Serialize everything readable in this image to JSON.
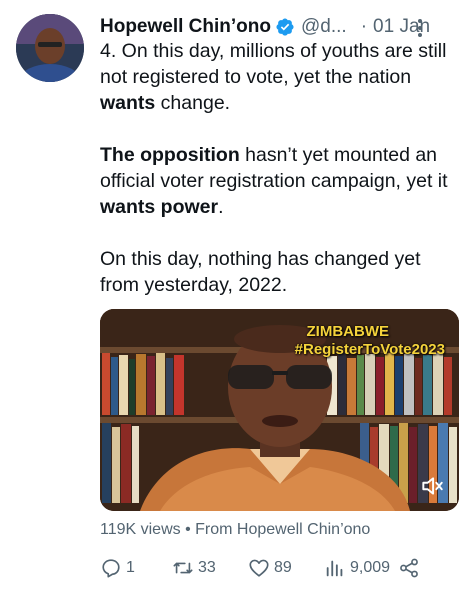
{
  "tweet": {
    "author_name": "Hopewell Chin’ono",
    "handle": "@d...",
    "separator": "·",
    "date": "01 Jan",
    "paragraphs": [
      [
        {
          "text": "4. On this day, millions of youths are still not registered to vote, yet the nation ",
          "bold": false
        },
        {
          "text": "wants",
          "bold": true
        },
        {
          "text": " change.",
          "bold": false
        }
      ],
      [
        {
          "text": "The opposition",
          "bold": true
        },
        {
          "text": " hasn’t yet mounted an official voter registration campaign, yet it ",
          "bold": false
        },
        {
          "text": "wants power",
          "bold": true
        },
        {
          "text": ".",
          "bold": false
        }
      ],
      [
        {
          "text": "On this day, nothing has changed yet from yesterday, 2022.",
          "bold": false
        }
      ]
    ],
    "media": {
      "overlay_line1": "ZIMBABWE",
      "overlay_line2": "#RegisterToVote2023",
      "overlay_color": "#f5d33b",
      "mute_icon": "speaker-muted-icon"
    },
    "views_line": "119K views • From Hopewell Chin’ono",
    "actions": {
      "replies": "1",
      "retweets": "33",
      "likes": "89",
      "views": "9,009"
    },
    "verified_color": "#1d9bf0",
    "text_color": "#0f1419",
    "muted_color": "#536471"
  }
}
